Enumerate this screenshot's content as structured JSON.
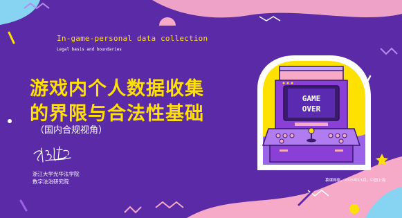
{
  "title_en": "In-game-personal data collection",
  "subtitle_en": "Legal basis and boundaries",
  "title_cn_line1": "游戏内个人数据收集",
  "title_cn_line2": "的界限与合法性基础",
  "scope": "（国内合规视角）",
  "author_signature": "李洁龍",
  "institution_line1": "浙江大学光华法学院",
  "institution_line2": "数字法治研究院",
  "note": "慕课网络，2025年11月，中国上海",
  "arcade_screen": {
    "line1": "GAME",
    "line2": "OVER"
  },
  "colors": {
    "background": "#5b2aa6",
    "title_yellow": "#ffe100",
    "pink": "#f7a9c8",
    "light_blue": "#86d3f2",
    "arcade_purple": "#8a3fd6"
  }
}
